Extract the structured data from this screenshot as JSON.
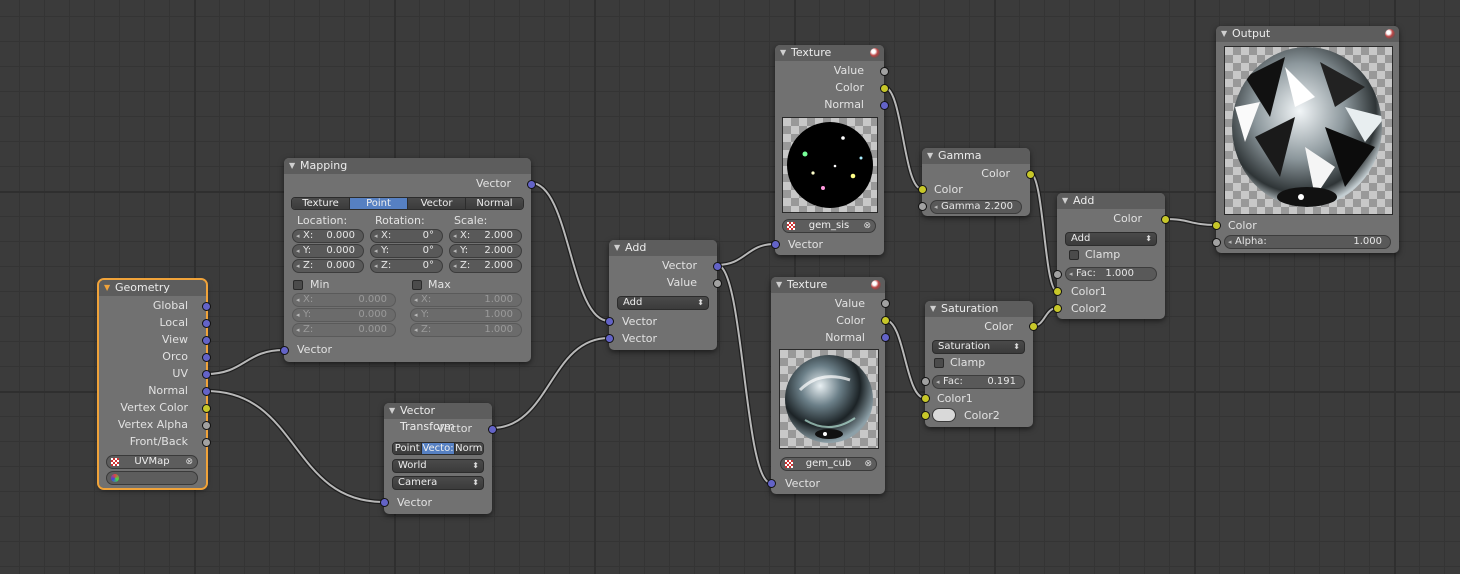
{
  "nodes": {
    "geometry": {
      "title": "Geometry",
      "outputs": [
        "Global",
        "Local",
        "View",
        "Orco",
        "UV",
        "Normal",
        "Vertex Color",
        "Vertex Alpha",
        "Front/Back"
      ],
      "uvmap": "UVMap",
      "vcol": ""
    },
    "mapping": {
      "title": "Mapping",
      "output": "Vector",
      "modes": [
        "Texture",
        "Point",
        "Vector",
        "Normal"
      ],
      "active_mode": "Point",
      "location_label": "Location:",
      "rotation_label": "Rotation:",
      "scale_label": "Scale:",
      "location": [
        {
          "k": "X:",
          "v": "0.000"
        },
        {
          "k": "Y:",
          "v": "0.000"
        },
        {
          "k": "Z:",
          "v": "0.000"
        }
      ],
      "rotation": [
        {
          "k": "X:",
          "v": "0°"
        },
        {
          "k": "Y:",
          "v": "0°"
        },
        {
          "k": "Z:",
          "v": "0°"
        }
      ],
      "scale": [
        {
          "k": "X:",
          "v": "2.000"
        },
        {
          "k": "Y:",
          "v": "2.000"
        },
        {
          "k": "Z:",
          "v": "2.000"
        }
      ],
      "min_label": "Min",
      "max_label": "Max",
      "min": [
        {
          "k": "X:",
          "v": "0.000"
        },
        {
          "k": "Y:",
          "v": "0.000"
        },
        {
          "k": "Z:",
          "v": "0.000"
        }
      ],
      "max": [
        {
          "k": "X:",
          "v": "1.000"
        },
        {
          "k": "Y:",
          "v": "1.000"
        },
        {
          "k": "Z:",
          "v": "1.000"
        }
      ],
      "input": "Vector"
    },
    "vector_transform": {
      "title": "Vector Transform",
      "output": "Vector",
      "modes": [
        "Point",
        "Vecto:",
        "Norm"
      ],
      "active_mode": "Vecto:",
      "convert_from": "World",
      "convert_to": "Camera",
      "input": "Vector"
    },
    "add_vec": {
      "title": "Add",
      "outputs": [
        "Vector",
        "Value"
      ],
      "operation": "Add",
      "inputs": [
        "Vector",
        "Vector"
      ]
    },
    "texture1": {
      "title": "Texture",
      "outputs": [
        "Value",
        "Color",
        "Normal"
      ],
      "texture_name": "gem_sis",
      "input": "Vector"
    },
    "texture2": {
      "title": "Texture",
      "outputs": [
        "Value",
        "Color",
        "Normal"
      ],
      "texture_name": "gem_cub",
      "input": "Vector"
    },
    "gamma": {
      "title": "Gamma",
      "output": "Color",
      "input": "Color",
      "gamma_label": "Gamma",
      "gamma_value": "2.200"
    },
    "saturation": {
      "title": "Saturation",
      "output": "Color",
      "blend_type": "Saturation",
      "clamp_label": "Clamp",
      "fac_label": "Fac:",
      "fac_value": "0.191",
      "color1": "Color1",
      "color2": "Color2"
    },
    "add_color": {
      "title": "Add",
      "output": "Color",
      "blend_type": "Add",
      "clamp_label": "Clamp",
      "fac_label": "Fac:",
      "fac_value": "1.000",
      "color1": "Color1",
      "color2": "Color2"
    },
    "output": {
      "title": "Output",
      "color_label": "Color",
      "alpha_label": "Alpha:",
      "alpha_value": "1.000"
    }
  },
  "colors": {
    "vector_socket": "#6363c7",
    "color_socket": "#c7c729",
    "value_socket": "#a1a1a1",
    "active_outline": "#f0a33a",
    "selected_button": "#5680c2"
  }
}
